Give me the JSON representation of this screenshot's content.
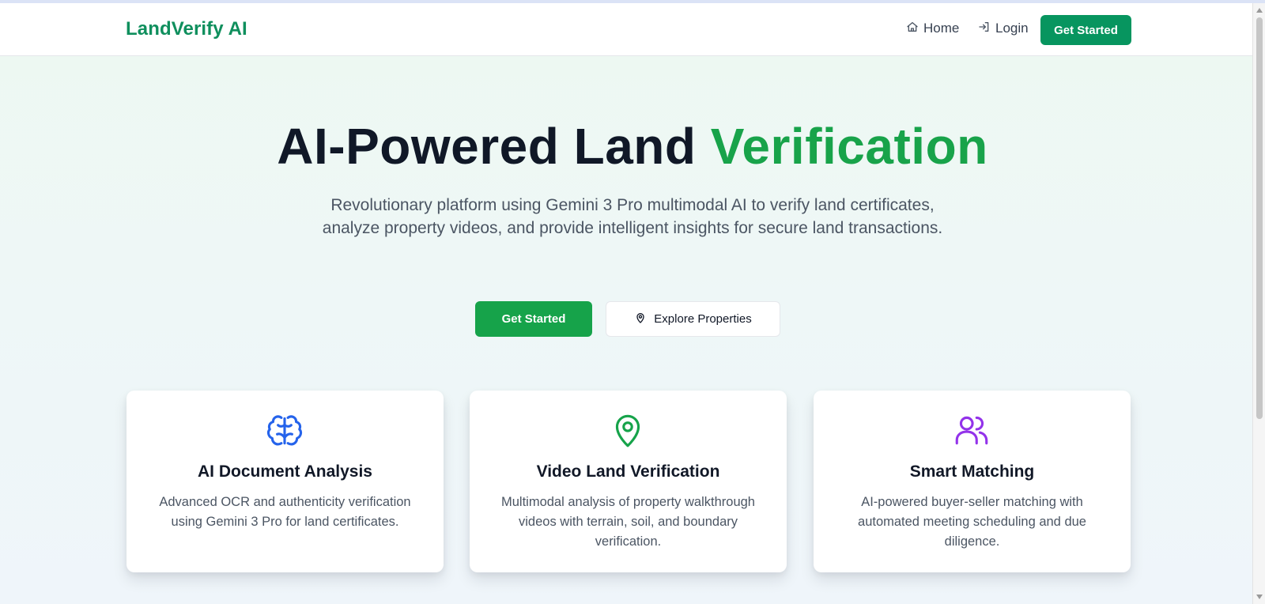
{
  "brand": {
    "name": "LandVerify AI",
    "color": "#0f8f5d"
  },
  "nav": {
    "home_label": "Home",
    "login_label": "Login",
    "cta_label": "Get Started",
    "icons": {
      "home": "home-icon",
      "login": "login-icon"
    }
  },
  "hero": {
    "title_main": "AI-Powered Land ",
    "title_accent": "Verification",
    "subtitle": "Revolutionary platform using Gemini 3 Pro multimodal AI to verify land certificates, analyze property videos, and provide intelligent insights for secure land transactions.",
    "primary_button": "Get Started",
    "secondary_button": "Explore Properties",
    "secondary_icon": "map-pin-icon",
    "accent_color": "#18a34a",
    "primary_color": "#16a34a"
  },
  "features": [
    {
      "title": "AI Document Analysis",
      "description": "Advanced OCR and authenticity verification using Gemini 3 Pro for land certificates.",
      "icon": "brain-icon",
      "icon_color": "#2563eb"
    },
    {
      "title": "Video Land Verification",
      "description": "Multimodal analysis of property walkthrough videos with terrain, soil, and boundary verification.",
      "icon": "map-pin-icon",
      "icon_color": "#16a34a"
    },
    {
      "title": "Smart Matching",
      "description": "AI-powered buyer-seller matching with automated meeting scheduling and due diligence.",
      "icon": "users-icon",
      "icon_color": "#9333ea"
    }
  ]
}
